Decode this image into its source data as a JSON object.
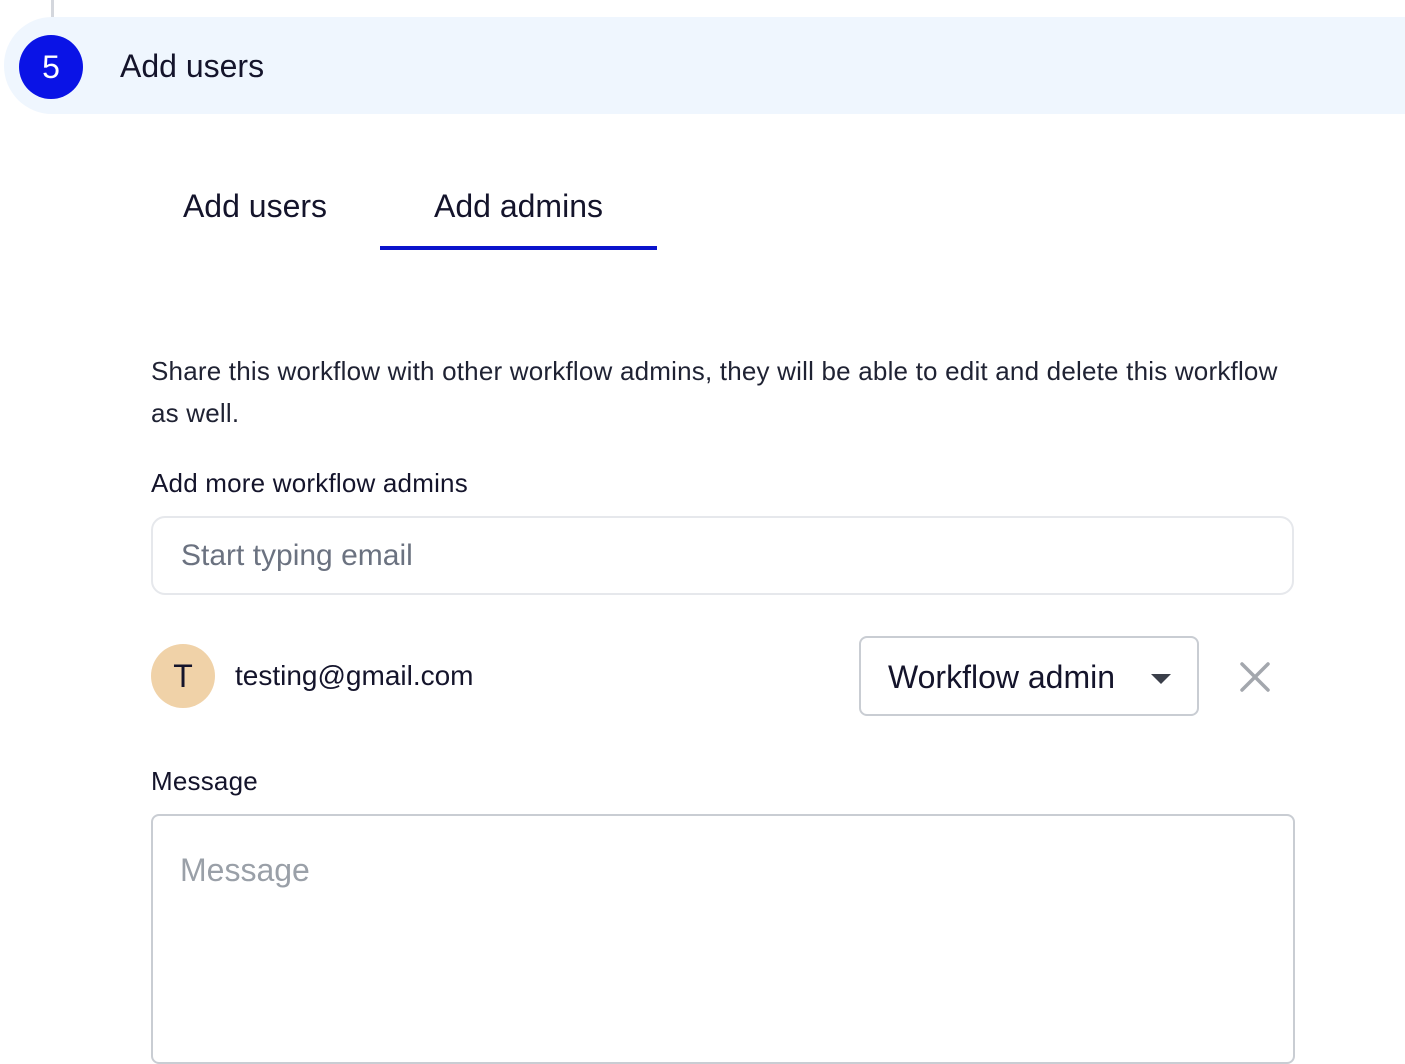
{
  "step": {
    "number": "5",
    "title": "Add users"
  },
  "tabs": [
    {
      "label": "Add users",
      "active": false
    },
    {
      "label": "Add admins",
      "active": true
    }
  ],
  "admins_panel": {
    "description": "Share this workflow with other workflow admins, they will be able to edit and delete this workflow as well.",
    "add_label": "Add more workflow admins",
    "email_placeholder": "Start typing email",
    "admins": [
      {
        "initial": "T",
        "email": "testing@gmail.com",
        "role": "Workflow admin"
      }
    ],
    "message_label": "Message",
    "message_placeholder": "Message"
  },
  "colors": {
    "accent": "#0a13e6",
    "header_bg": "#eff6fe",
    "avatar_bg": "#f0d2a8"
  }
}
